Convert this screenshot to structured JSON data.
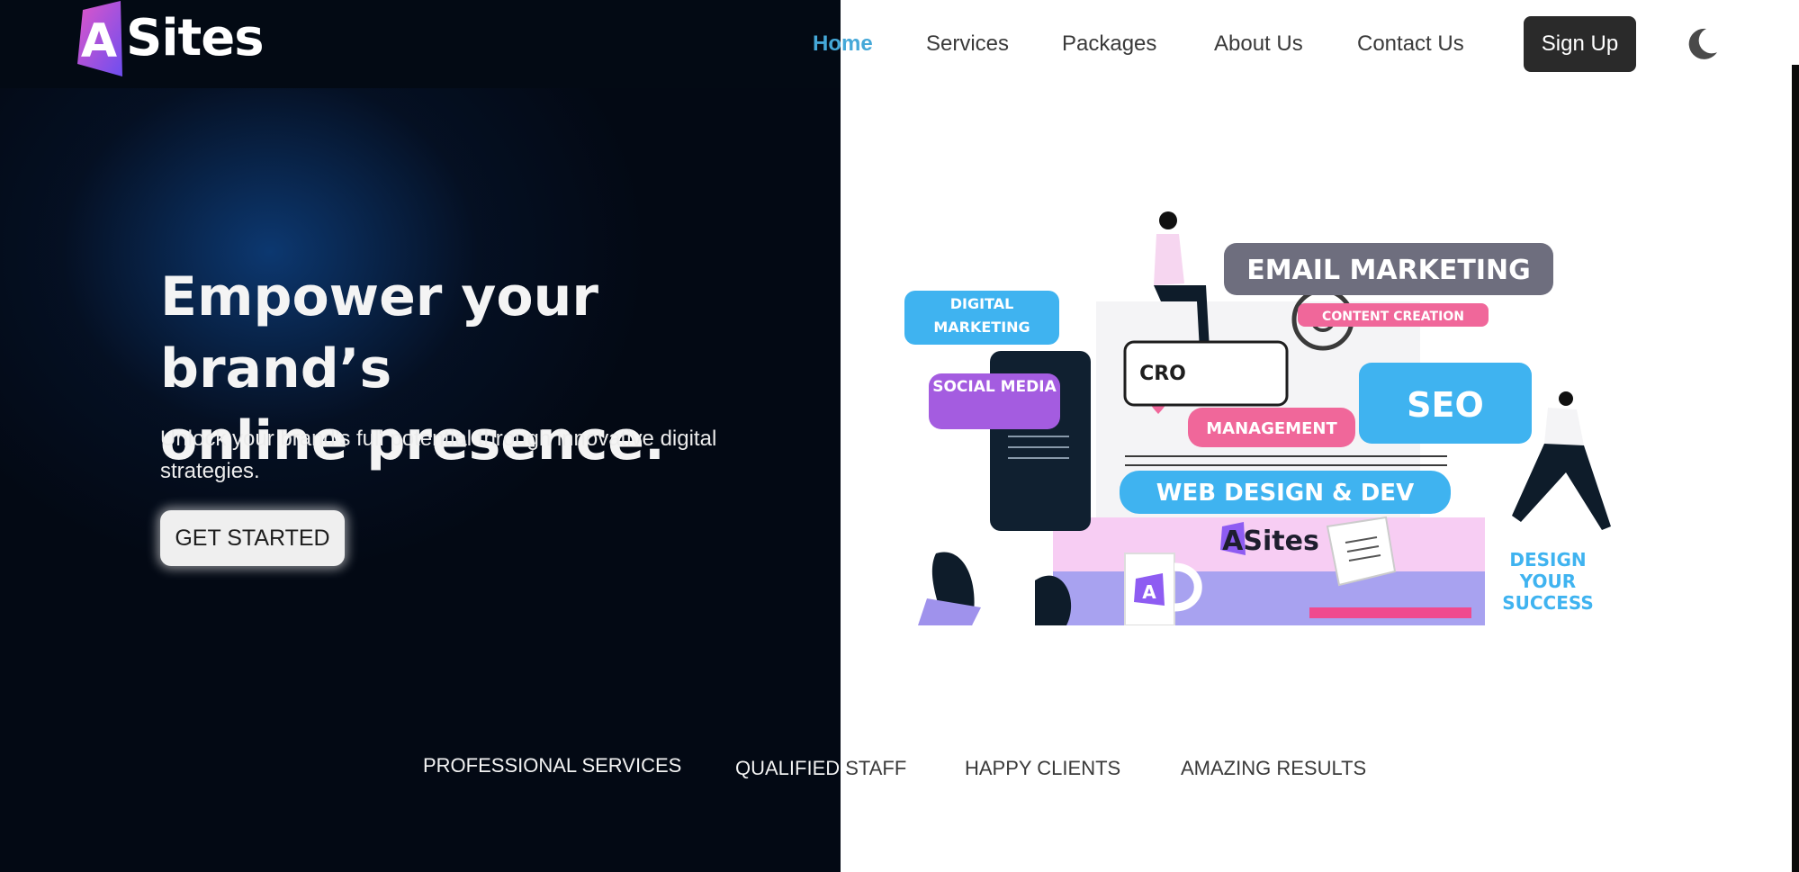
{
  "brand": {
    "name": "Sites",
    "logo_letter": "A"
  },
  "nav": {
    "items": [
      {
        "label": "Home",
        "active": true
      },
      {
        "label": "Services",
        "active": false
      },
      {
        "label": "Packages",
        "active": false
      },
      {
        "label": "About Us",
        "active": false
      },
      {
        "label": "Contact Us",
        "active": false
      }
    ],
    "signup_label": "Sign Up",
    "theme_icon": "moon-icon"
  },
  "hero": {
    "title_line1": "Empower your brand’s",
    "title_line2": "online presence.",
    "subtitle": "Unlock your brand's full potential through innovative digital strategies.",
    "cta_label": "GET STARTED"
  },
  "illustration": {
    "tags": {
      "email_marketing": "EMAIL MARKETING",
      "digital_marketing": "DIGITAL MARKETING",
      "content_creation": "CONTENT CREATION",
      "cro": "CRO",
      "social_media": "SOCIAL MEDIA",
      "seo": "SEO",
      "management": "MANAGEMENT",
      "web_design": "WEB DESIGN & DEV",
      "brand": "ASites",
      "mug_letter": "A",
      "slogan": "DESIGN YOUR SUCCESS"
    }
  },
  "stats": {
    "items": [
      "PROFESSIONAL SERVICES",
      "QUALIFIED STAFF",
      "HAPPY CLIENTS",
      "AMAZING RESULTS"
    ]
  },
  "colors": {
    "dark_bg": "#030914",
    "accent_blue": "#45a8d8",
    "logo_purple": "#8e5cf2",
    "logo_pink": "#e056c8",
    "tag_blue": "#3fb3f0",
    "tag_purple": "#a45ce0",
    "tag_pink": "#f0679a",
    "tag_gray": "#6e6e7e"
  }
}
